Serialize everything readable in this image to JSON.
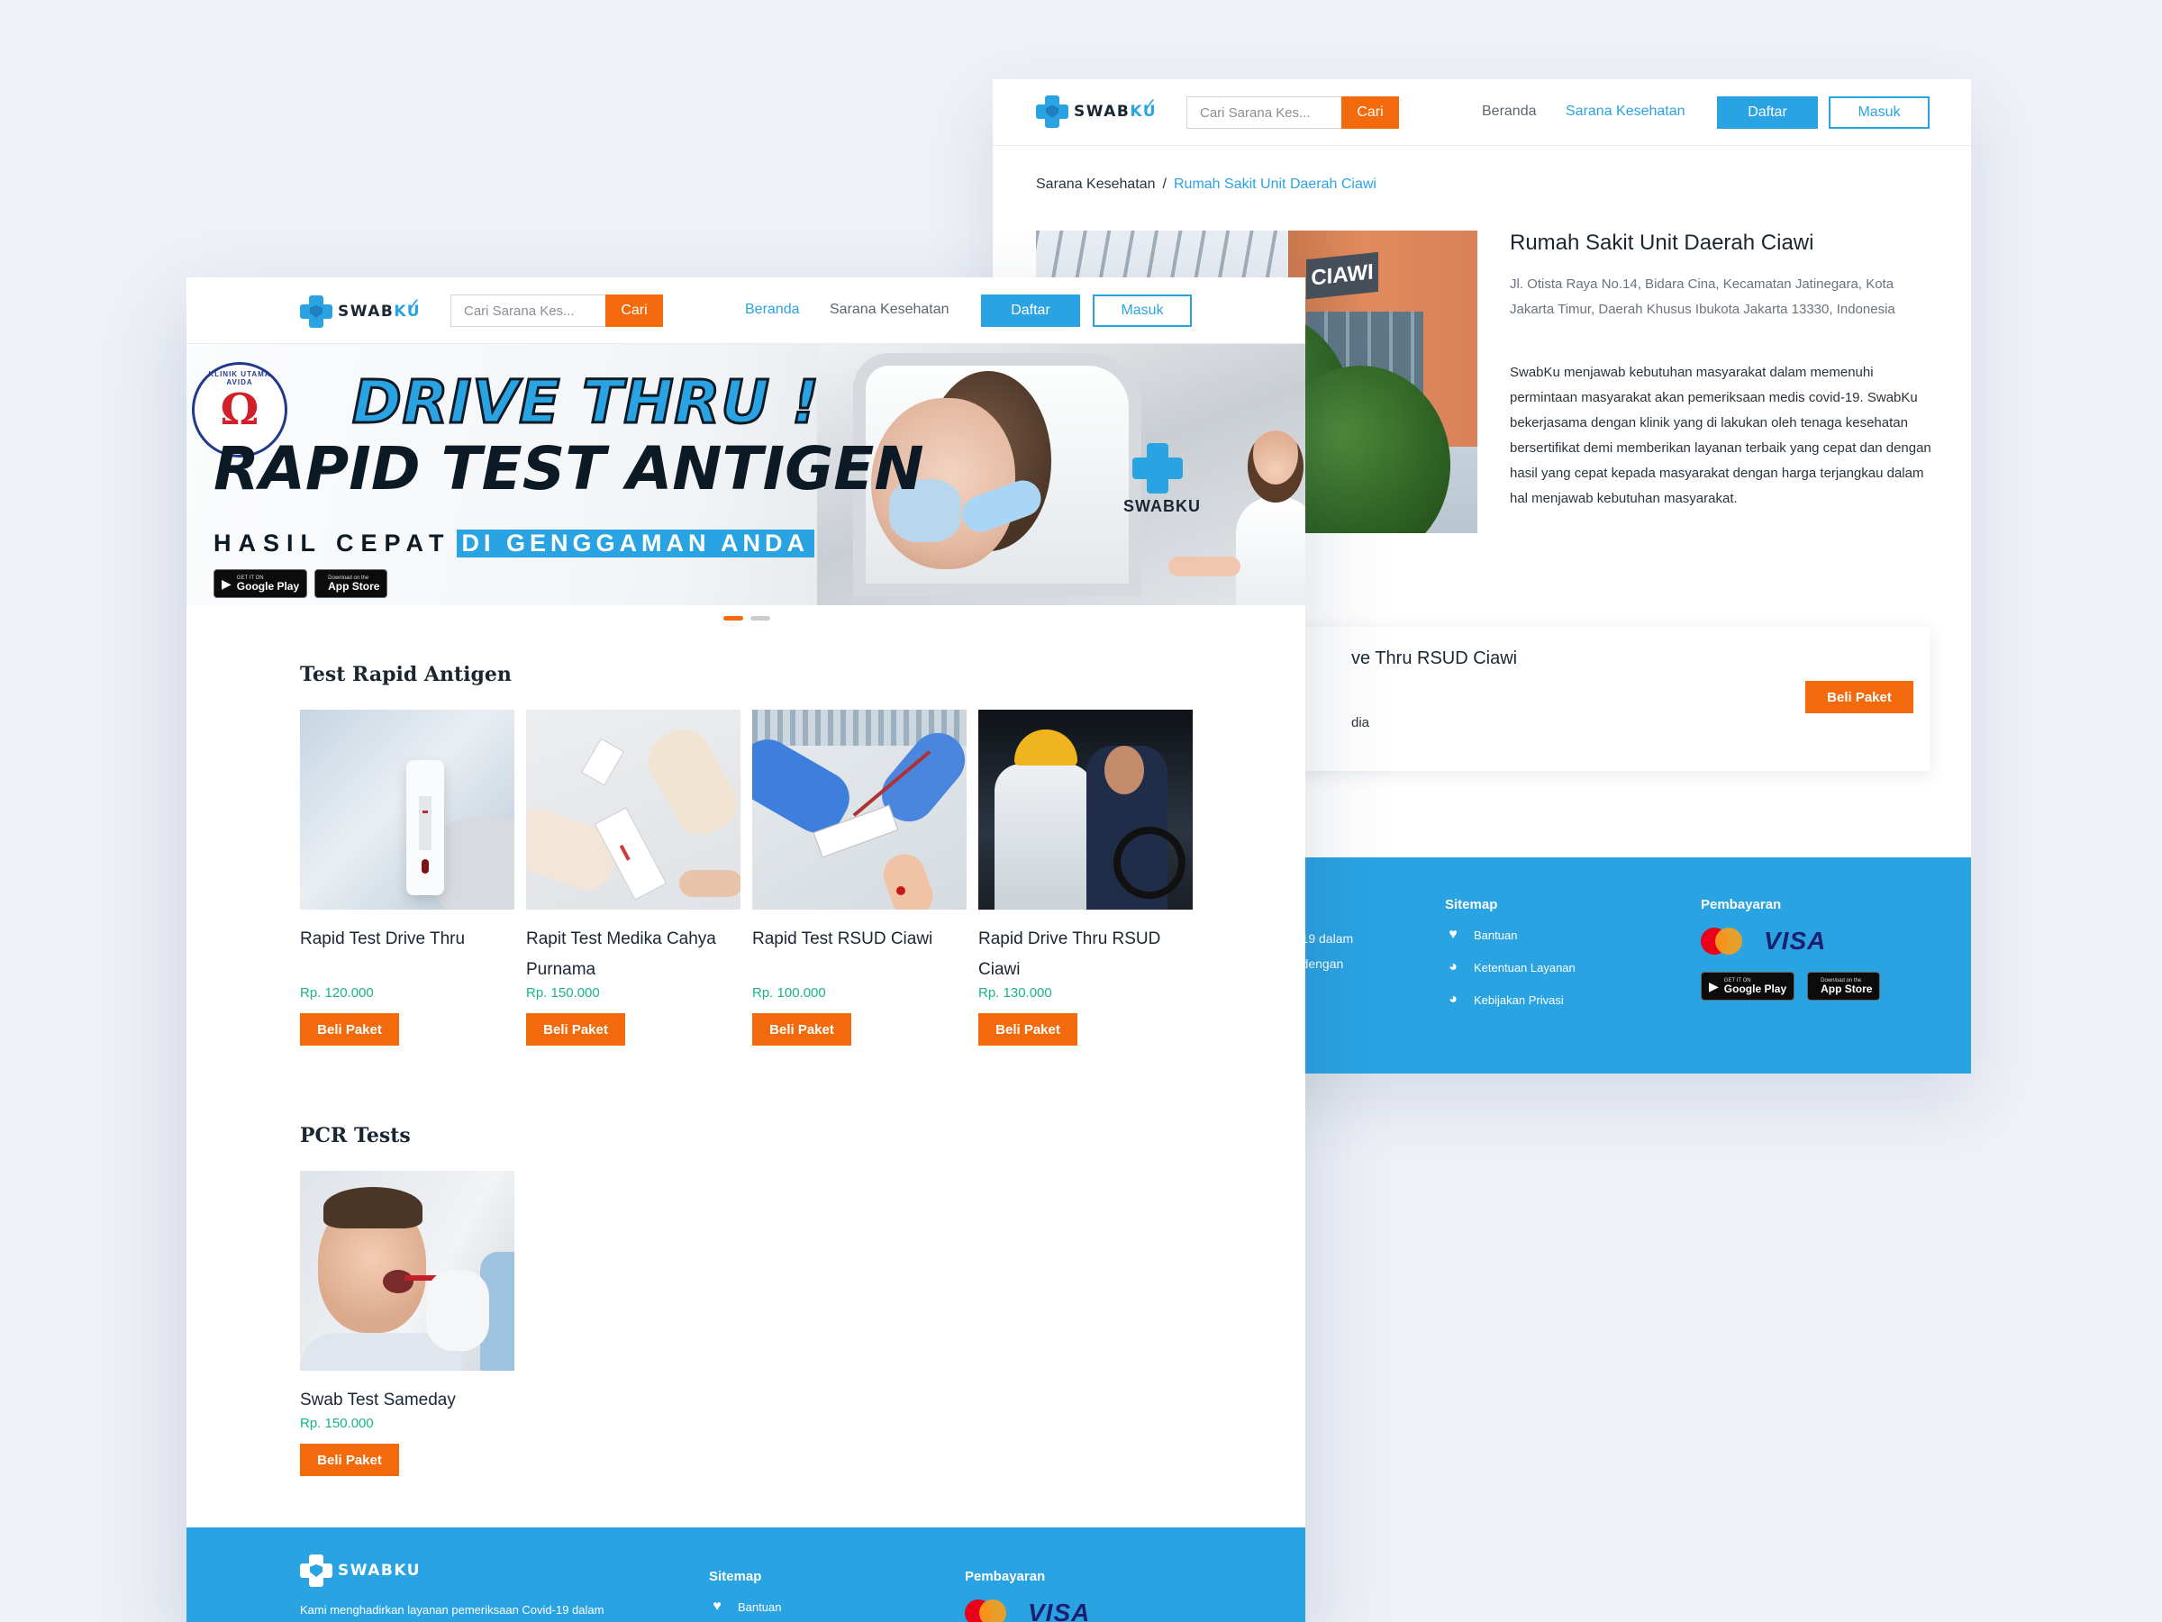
{
  "back": {
    "nav": {
      "logo": "SWABKU",
      "search_placeholder": "Cari Sarana Kes...",
      "search_button": "Cari",
      "links": [
        "Beranda",
        "Sarana Kesehatan"
      ],
      "daftar": "Daftar",
      "masuk": "Masuk"
    },
    "breadcrumb": {
      "root": "Sarana Kesehatan",
      "sep": "/",
      "current": "Rumah Sakit Unit Daerah Ciawi"
    },
    "hospital": {
      "photo_sign": "CIAWI",
      "title": "Rumah Sakit Unit Daerah Ciawi",
      "address": "Jl. Otista Raya No.14, Bidara Cina, Kecamatan Jatinegara, Kota Jakarta Timur, Daerah Khusus Ibukota Jakarta 13330, Indonesia",
      "description": "SwabKu menjawab kebutuhan masyarakat dalam memenuhi permintaan masyarakat akan pemeriksaan medis covid-19. SwabKu bekerjasama dengan klinik yang di lakukan oleh tenaga kesehatan bersertifikat demi memberikan layanan terbaik yang cepat dan dengan hasil yang cepat kepada masyarakat dengan harga terjangkau dalam hal menjawab kebutuhan masyarakat."
    },
    "package": {
      "title_visible": "ve Thru RSUD Ciawi",
      "sub_visible": "dia",
      "button": "Beli Paket"
    },
    "footer": {
      "left_text": "vid-19 dalam\nest dengan",
      "sitemap_title": "Sitemap",
      "sitemap_items": [
        {
          "label": "Bantuan",
          "icon": "heart-icon"
        },
        {
          "label": "Ketentuan Layanan",
          "icon": "globe-icon"
        },
        {
          "label": "Kebijakan Privasi",
          "icon": "globe-icon"
        }
      ],
      "payment_title": "Pembayaran",
      "payment_methods": [
        "mastercard",
        "VISA"
      ],
      "stores": [
        {
          "small": "GET IT ON",
          "big": "Google Play"
        },
        {
          "small": "Download on the",
          "big": "App Store"
        }
      ]
    }
  },
  "front": {
    "nav": {
      "logo": "SWABKU",
      "search_placeholder": "Cari Sarana Kes...",
      "search_button": "Cari",
      "links": [
        "Beranda",
        "Sarana Kesehatan"
      ],
      "daftar": "Daftar",
      "masuk": "Masuk"
    },
    "hero": {
      "badge": "KLINIK UTAMA AVIDA",
      "line1": "DRIVE THRU !",
      "line2": "RAPID TEST ANTIGEN",
      "line3a": "HASIL CEPAT",
      "line3b": "DI GENGGAMAN ANDA",
      "stores": [
        {
          "small": "GET IT ON",
          "big": "Google Play"
        },
        {
          "small": "Download on the",
          "big": "App Store"
        }
      ],
      "brand": "SWABKU",
      "slides": 2,
      "active_slide": 1
    },
    "section_antigen": {
      "title": "Test Rapid Antigen",
      "cards": [
        {
          "title": "Rapid Test Drive Thru",
          "price": "Rp. 120.000",
          "button": "Beli Paket"
        },
        {
          "title": "Rapit Test Medika Cahya Purnama",
          "price": "Rp. 150.000",
          "button": "Beli Paket"
        },
        {
          "title": "Rapid Test RSUD Ciawi",
          "price": "Rp. 100.000",
          "button": "Beli Paket"
        },
        {
          "title": "Rapid Drive Thru RSUD Ciawi",
          "price": "Rp. 130.000",
          "button": "Beli Paket"
        }
      ]
    },
    "section_pcr": {
      "title": "PCR Tests",
      "cards": [
        {
          "title": "Swab Test Sameday",
          "price": "Rp. 150.000",
          "button": "Beli Paket"
        }
      ]
    },
    "footer": {
      "logo": "SWABKU",
      "tagline": "Kami menghadirkan layanan pemeriksaan Covid-19 dalam",
      "sitemap_title": "Sitemap",
      "sitemap_items": [
        {
          "label": "Bantuan",
          "icon": "heart-icon"
        }
      ],
      "payment_title": "Pembayaran",
      "payment_methods": [
        "mastercard",
        "VISA"
      ]
    }
  },
  "colors": {
    "brand_blue": "#2aa3e3",
    "cta_orange": "#f26a0c",
    "price_green": "#19b38a"
  }
}
